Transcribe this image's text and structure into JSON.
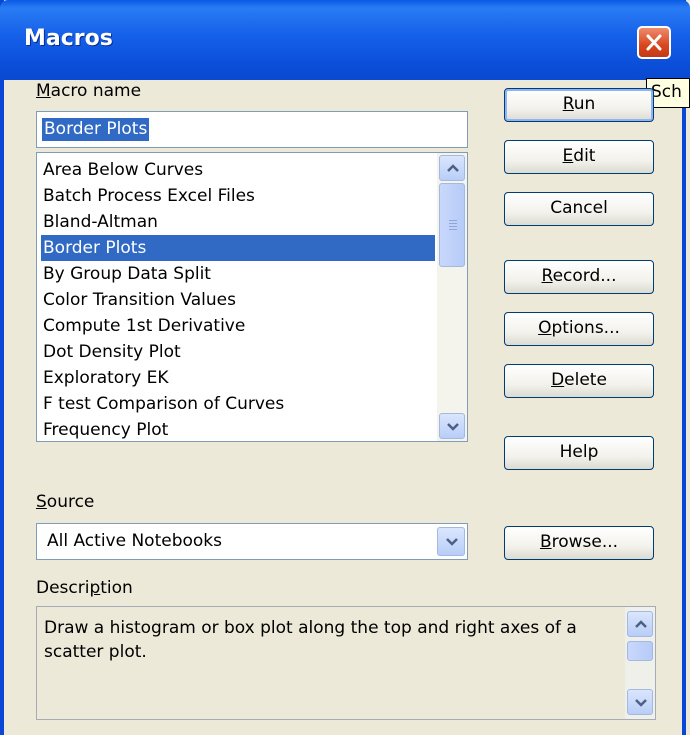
{
  "window": {
    "title": "Macros"
  },
  "tooltip": {
    "text": "Sch"
  },
  "macro_name": {
    "label_pre": "",
    "label_accel": "M",
    "label_post": "acro name",
    "value": "Border Plots"
  },
  "macro_list": {
    "items": [
      "Area Below Curves",
      "Batch Process Excel Files",
      "Bland-Altman",
      "Border Plots",
      "By Group Data Split",
      "Color Transition Values",
      "Compute 1st Derivative",
      "Dot Density Plot",
      "Exploratory EK",
      "F test Comparison of Curves",
      "Frequency Plot"
    ],
    "selected": "Border Plots"
  },
  "buttons": {
    "run": {
      "pre": "",
      "accel": "R",
      "post": "un"
    },
    "edit": {
      "pre": "",
      "accel": "E",
      "post": "dit"
    },
    "cancel": {
      "pre": "Cancel",
      "accel": "",
      "post": ""
    },
    "record": {
      "pre": "",
      "accel": "R",
      "post": "ecord..."
    },
    "options": {
      "pre": "",
      "accel": "O",
      "post": "ptions..."
    },
    "delete": {
      "pre": "",
      "accel": "D",
      "post": "elete"
    },
    "help": {
      "pre": "Help",
      "accel": "",
      "post": ""
    },
    "browse": {
      "pre": "",
      "accel": "B",
      "post": "rowse..."
    }
  },
  "source": {
    "label_pre": "",
    "label_accel": "S",
    "label_post": "ource",
    "value": "All Active Notebooks"
  },
  "description": {
    "label_pre": "Descri",
    "label_accel": "p",
    "label_post": "tion",
    "text": "Draw a histogram or box plot along the top and right axes of a scatter plot."
  },
  "colors": {
    "title_bar": "#0a5ae6",
    "selection": "#316ac5",
    "close_button": "#d8461f"
  },
  "icons": {
    "close": "close-icon",
    "scroll_up": "chevron-up-icon",
    "scroll_down": "chevron-down-icon",
    "dropdown": "chevron-down-icon"
  }
}
